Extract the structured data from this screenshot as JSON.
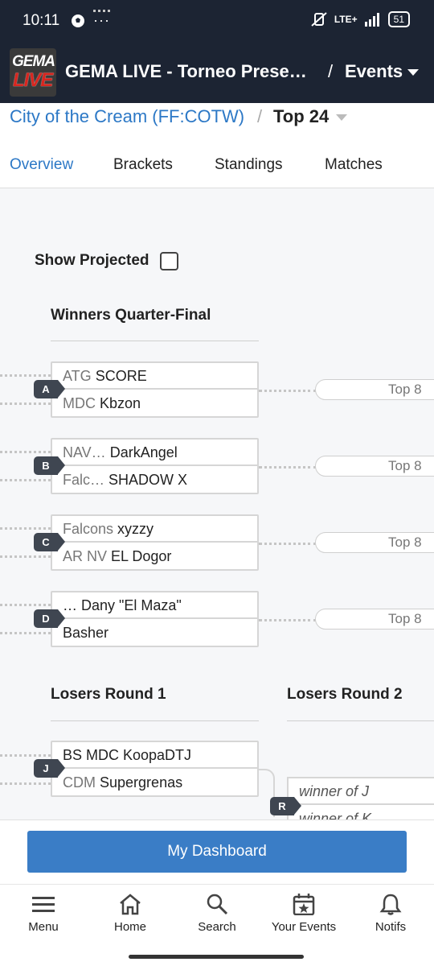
{
  "status_bar": {
    "time": "10:11",
    "overflow": "···",
    "network": "LTE+",
    "battery": "51"
  },
  "header": {
    "app_title": "GEMA LIVE - Torneo Presentado por ...",
    "separator": "/",
    "events_label": "Events",
    "logo_top": "GEMA",
    "logo_bottom": "LIVE"
  },
  "breadcrumb": {
    "event": "City of the Cream (FF:COTW)",
    "separator": "/",
    "phase": "Top 24"
  },
  "tabs": [
    {
      "label": "Overview",
      "active": true
    },
    {
      "label": "Brackets",
      "active": false
    },
    {
      "label": "Standings",
      "active": false
    },
    {
      "label": "Matches",
      "active": false
    }
  ],
  "bracket": {
    "show_projected_label": "Show Projected",
    "show_projected_checked": false,
    "winners_round_title": "Winners Quarter-Final",
    "losers_round1_title": "Losers Round 1",
    "losers_round2_title": "Losers Round 2",
    "winners_sets": [
      {
        "id": "A",
        "top": {
          "prefix": "ATG",
          "name": "SCORE"
        },
        "bottom": {
          "prefix": "MDC",
          "name": "Kbzon"
        },
        "projected": "Top 8"
      },
      {
        "id": "B",
        "top": {
          "prefix": "NAV…",
          "name": "DarkAngel"
        },
        "bottom": {
          "prefix": "Falc…",
          "name": "SHADOW X"
        },
        "projected": "Top 8"
      },
      {
        "id": "C",
        "top": {
          "prefix": "Falcons",
          "name": "xyzzy"
        },
        "bottom": {
          "prefix": "AR NV",
          "name": "EL Dogor"
        },
        "projected": "Top 8"
      },
      {
        "id": "D",
        "top": {
          "prefix": "",
          "name": "… Dany \"El Maza\""
        },
        "bottom": {
          "prefix": "",
          "name": "Basher"
        },
        "projected": "Top 8"
      }
    ],
    "losers_sets": [
      {
        "id": "J",
        "top": {
          "prefix": "",
          "name": "BS MDC KoopaDTJ"
        },
        "bottom": {
          "prefix": "CDM",
          "name": "Supergrenas"
        }
      }
    ],
    "losers_r2_sets": [
      {
        "id": "R",
        "top": "winner of J",
        "bottom": "winner of K"
      }
    ]
  },
  "dashboard_button": "My Dashboard",
  "bottom_nav": [
    {
      "label": "Menu",
      "icon": "menu-icon"
    },
    {
      "label": "Home",
      "icon": "home-icon"
    },
    {
      "label": "Search",
      "icon": "search-icon"
    },
    {
      "label": "Your Events",
      "icon": "calendar-icon"
    },
    {
      "label": "Notifs",
      "icon": "bell-icon"
    }
  ],
  "colors": {
    "header_bg": "#1c2433",
    "link": "#2c78c6",
    "button": "#3a7dc6",
    "set_id_bg": "#3f4651"
  }
}
